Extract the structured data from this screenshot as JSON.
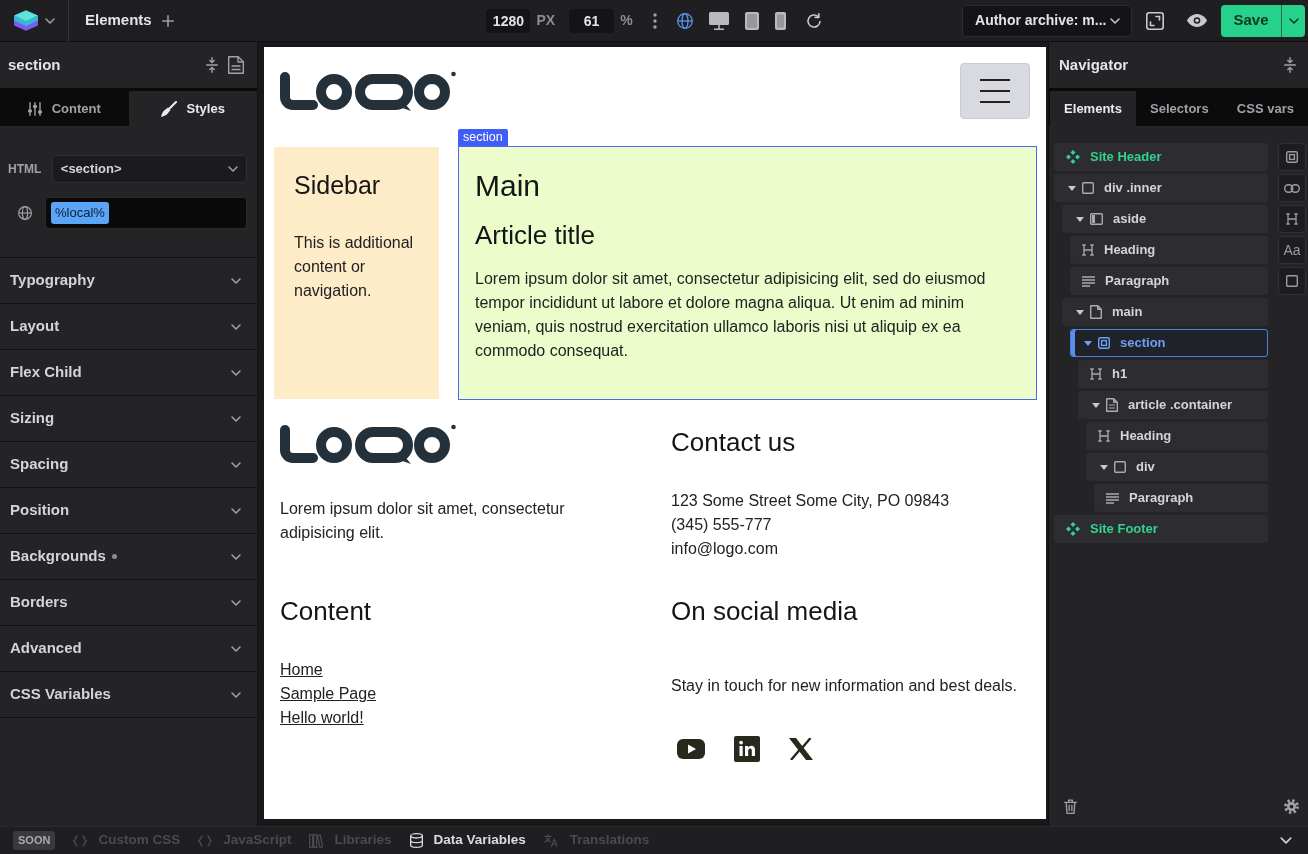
{
  "top_bar": {
    "panel_label": "Elements",
    "width_value": "1280",
    "width_unit": "PX",
    "zoom_value": "61",
    "zoom_unit": "%",
    "breakpoints": [
      {
        "kind": "global",
        "selected": true
      },
      {
        "kind": "desktop",
        "selected": false
      },
      {
        "kind": "tablet",
        "selected": false
      },
      {
        "kind": "mobile",
        "selected": false
      }
    ],
    "template": "Author archive: m...",
    "save_label": "Save"
  },
  "left_panel": {
    "title": "section",
    "tabs": [
      {
        "label": "Content",
        "selected": false
      },
      {
        "label": "Styles",
        "selected": true
      }
    ],
    "html_label": "HTML",
    "html_tag": "<section>",
    "selector": "%local%",
    "groups": [
      {
        "label": "Typography",
        "has_value": false
      },
      {
        "label": "Layout",
        "has_value": false
      },
      {
        "label": "Flex Child",
        "has_value": false
      },
      {
        "label": "Sizing",
        "has_value": false
      },
      {
        "label": "Spacing",
        "has_value": false
      },
      {
        "label": "Position",
        "has_value": false
      },
      {
        "label": "Backgrounds",
        "has_value": true
      },
      {
        "label": "Borders",
        "has_value": false
      },
      {
        "label": "Advanced",
        "has_value": false
      },
      {
        "label": "CSS Variables",
        "has_value": false
      }
    ]
  },
  "canvas": {
    "sidebar": {
      "heading": "Sidebar",
      "text": "This is additional content or navigation."
    },
    "main": {
      "selected": true,
      "tag": "section",
      "heading": "Main",
      "article_title": "Article title",
      "text": "Lorem ipsum dolor sit amet, consectetur adipisicing elit, sed do eiusmod tempor incididunt ut labore et dolore magna aliqua. Ut enim ad minim veniam, quis nostrud exercitation ullamco laboris nisi ut aliquip ex ea commodo consequat."
    },
    "footer": {
      "about_text": "Lorem ipsum dolor sit amet, consectetur adipisicing elit.",
      "contact_heading": "Contact us",
      "contact_lines": [
        "123 Some Street Some City, PO 09843",
        "(345) 555-777",
        "info@logo.com"
      ],
      "content_heading": "Content",
      "links": [
        "Home",
        "Sample Page",
        "Hello world!"
      ],
      "social_heading": "On social media",
      "social_text": "Stay in touch for new information and best deals."
    }
  },
  "navigator": {
    "title": "Navigator",
    "tabs": [
      {
        "label": "Elements",
        "selected": true
      },
      {
        "label": "Selectors",
        "selected": false
      },
      {
        "label": "CSS vars",
        "selected": false
      }
    ],
    "tree": [
      {
        "kind": "component",
        "label": "Site Header",
        "selected": false
      },
      {
        "kind": "div",
        "label": "div .inner",
        "selected": false,
        "expanded": true,
        "children": [
          {
            "kind": "aside",
            "label": "aside",
            "selected": false,
            "expanded": true,
            "children": [
              {
                "kind": "heading",
                "label": "Heading",
                "selected": false
              },
              {
                "kind": "paragraph",
                "label": "Paragraph",
                "selected": false
              }
            ]
          },
          {
            "kind": "main",
            "label": "main",
            "selected": false,
            "expanded": true,
            "children": [
              {
                "kind": "section",
                "label": "section",
                "selected": true,
                "expanded": true,
                "children": [
                  {
                    "kind": "heading",
                    "label": "h1",
                    "selected": false
                  },
                  {
                    "kind": "article",
                    "label": "article .container",
                    "selected": false,
                    "expanded": true,
                    "children": [
                      {
                        "kind": "heading",
                        "label": "Heading",
                        "selected": false
                      },
                      {
                        "kind": "div",
                        "label": "div",
                        "selected": false,
                        "expanded": true,
                        "children": [
                          {
                            "kind": "paragraph",
                            "label": "Paragraph",
                            "selected": false
                          }
                        ]
                      }
                    ]
                  }
                ]
              }
            ]
          }
        ]
      },
      {
        "kind": "component",
        "label": "Site Footer",
        "selected": false
      }
    ],
    "tool_glyph": "Aa"
  },
  "bottom_bar": {
    "badge": "SOON",
    "items": [
      {
        "kind": "code",
        "label": "Custom CSS",
        "disabled": true
      },
      {
        "kind": "code",
        "label": "JavaScript",
        "disabled": true
      },
      {
        "kind": "library",
        "label": "Libraries",
        "disabled": true
      },
      {
        "kind": "data",
        "label": "Data Variables",
        "disabled": false
      },
      {
        "kind": "translate",
        "label": "Translations",
        "disabled": true
      }
    ]
  }
}
